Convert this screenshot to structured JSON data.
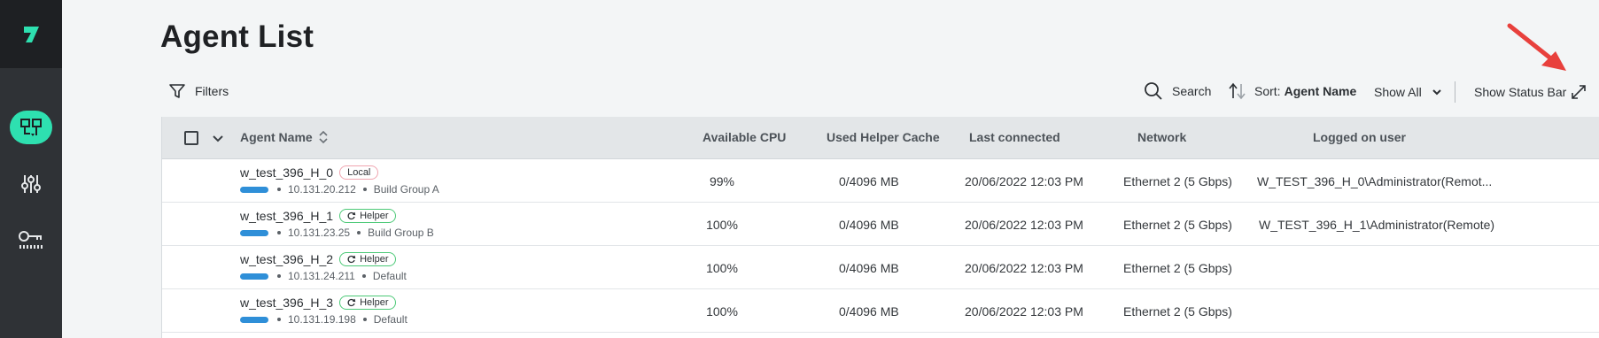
{
  "page": {
    "title": "Agent List"
  },
  "sidebar": {
    "items": [
      {
        "icon": "agents-icon",
        "active": true
      },
      {
        "icon": "sliders-icon",
        "active": false
      },
      {
        "icon": "key-icon",
        "active": false
      }
    ]
  },
  "toolbar": {
    "filters_label": "Filters",
    "search_label": "Search",
    "sort_prefix": "Sort:",
    "sort_value": "Agent Name",
    "show_all_label": "Show All",
    "status_bar_label": "Show Status Bar"
  },
  "table": {
    "columns": {
      "agent_name": "Agent Name",
      "available_cpu": "Available CPU",
      "used_helper_cache": "Used Helper Cache",
      "last_connected": "Last connected",
      "network": "Network",
      "logged_on_user": "Logged on user"
    },
    "rows": [
      {
        "name": "w_test_396_H_0",
        "badge": "Local",
        "badge_type": "local",
        "ip": "10.131.20.212",
        "group": "Build Group A",
        "cpu": "99%",
        "cache": "0/4096 MB",
        "last_connected": "20/06/2022 12:03 PM",
        "network": "Ethernet 2 (5 Gbps)",
        "user": "W_TEST_396_H_0\\Administrator(Remot..."
      },
      {
        "name": "w_test_396_H_1",
        "badge": "Helper",
        "badge_type": "helper",
        "ip": "10.131.23.25",
        "group": "Build Group B",
        "cpu": "100%",
        "cache": "0/4096 MB",
        "last_connected": "20/06/2022 12:03 PM",
        "network": "Ethernet 2 (5 Gbps)",
        "user": "W_TEST_396_H_1\\Administrator(Remote)"
      },
      {
        "name": "w_test_396_H_2",
        "badge": "Helper",
        "badge_type": "helper",
        "ip": "10.131.24.211",
        "group": "Default",
        "cpu": "100%",
        "cache": "0/4096 MB",
        "last_connected": "20/06/2022 12:03 PM",
        "network": "Ethernet 2 (5 Gbps)",
        "user": ""
      },
      {
        "name": "w_test_396_H_3",
        "badge": "Helper",
        "badge_type": "helper",
        "ip": "10.131.19.198",
        "group": "Default",
        "cpu": "100%",
        "cache": "0/4096 MB",
        "last_connected": "20/06/2022 12:03 PM",
        "network": "Ethernet 2 (5 Gbps)",
        "user": ""
      }
    ]
  },
  "annotation": {
    "arrow_color": "#e8403c"
  }
}
